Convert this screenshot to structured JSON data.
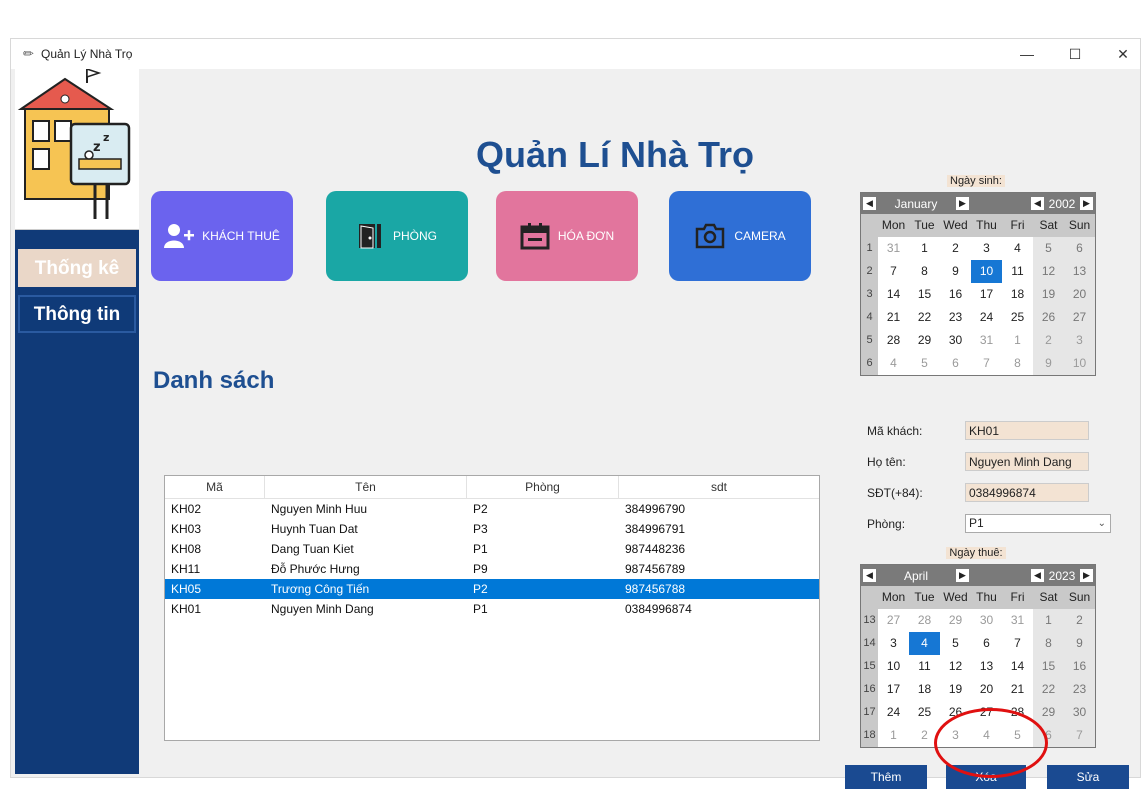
{
  "window": {
    "title": "Quản Lý Nhà Trọ"
  },
  "sidebar": {
    "items": [
      {
        "label": "Thống kê"
      },
      {
        "label": "Thông tin"
      }
    ]
  },
  "header": {
    "title": "Quản Lí Nhà Trọ"
  },
  "tiles": [
    {
      "label": "KHÁCH THUÊ",
      "color": "#6b63ee",
      "icon": "add-user-icon"
    },
    {
      "label": "PHÒNG",
      "color": "#1aa7a5",
      "icon": "door-icon"
    },
    {
      "label": "HÓA ĐƠN",
      "color": "#e2759d",
      "icon": "calendar-icon"
    },
    {
      "label": "CAMERA",
      "color": "#2f6fd6",
      "icon": "camera-icon"
    }
  ],
  "list": {
    "title": "Danh sách",
    "columns": [
      "Mã",
      "Tên",
      "Phòng",
      "sdt"
    ],
    "rows": [
      [
        "KH02",
        "Nguyen Minh Huu",
        "P2",
        "384996790"
      ],
      [
        "KH03",
        "Huynh Tuan Dat",
        "P3",
        "384996791"
      ],
      [
        "KH08",
        "Dang Tuan Kiet",
        "P1",
        "987448236"
      ],
      [
        "KH11",
        "Đỗ Phước Hưng",
        "P9",
        "987456789"
      ],
      [
        "KH05",
        "Trương Công Tiến",
        "P2",
        "987456788"
      ],
      [
        "KH01",
        "Nguyen Minh Dang",
        "P1",
        "0384996874"
      ]
    ],
    "selected_row": 4
  },
  "birth_calendar": {
    "label": "Ngày sinh:",
    "month": "January",
    "year": "2002",
    "weekdays": [
      "Mon",
      "Tue",
      "Wed",
      "Thu",
      "Fri",
      "Sat",
      "Sun"
    ],
    "weeks": [
      {
        "num": "1",
        "days": [
          "31",
          "1",
          "2",
          "3",
          "4",
          "5",
          "6"
        ]
      },
      {
        "num": "2",
        "days": [
          "7",
          "8",
          "9",
          "10",
          "11",
          "12",
          "13"
        ]
      },
      {
        "num": "3",
        "days": [
          "14",
          "15",
          "16",
          "17",
          "18",
          "19",
          "20"
        ]
      },
      {
        "num": "4",
        "days": [
          "21",
          "22",
          "23",
          "24",
          "25",
          "26",
          "27"
        ]
      },
      {
        "num": "5",
        "days": [
          "28",
          "29",
          "30",
          "31",
          "1",
          "2",
          "3"
        ]
      },
      {
        "num": "6",
        "days": [
          "4",
          "5",
          "6",
          "7",
          "8",
          "9",
          "10"
        ]
      }
    ],
    "first_week_prev_count": 1,
    "last_in_month_index": 30,
    "selected": "10"
  },
  "form": {
    "ma_khach": {
      "label": "Mã khách:",
      "value": "KH01"
    },
    "ho_ten": {
      "label": "Họ tên:",
      "value": "Nguyen Minh Dang"
    },
    "sdt": {
      "label": "SĐT(+84):",
      "value": "0384996874"
    },
    "phong": {
      "label": "Phòng:",
      "value": "P1"
    }
  },
  "rent_calendar": {
    "label": "Ngày thuê:",
    "month": "April",
    "year": "2023",
    "weekdays": [
      "Mon",
      "Tue",
      "Wed",
      "Thu",
      "Fri",
      "Sat",
      "Sun"
    ],
    "weeks": [
      {
        "num": "13",
        "days": [
          "27",
          "28",
          "29",
          "30",
          "31",
          "1",
          "2"
        ]
      },
      {
        "num": "14",
        "days": [
          "3",
          "4",
          "5",
          "6",
          "7",
          "8",
          "9"
        ]
      },
      {
        "num": "15",
        "days": [
          "10",
          "11",
          "12",
          "13",
          "14",
          "15",
          "16"
        ]
      },
      {
        "num": "16",
        "days": [
          "17",
          "18",
          "19",
          "20",
          "21",
          "22",
          "23"
        ]
      },
      {
        "num": "17",
        "days": [
          "24",
          "25",
          "26",
          "27",
          "28",
          "29",
          "30"
        ]
      },
      {
        "num": "18",
        "days": [
          "1",
          "2",
          "3",
          "4",
          "5",
          "6",
          "7"
        ]
      }
    ],
    "first_week_prev_count": 5,
    "last_in_month_index": 34,
    "selected": "4"
  },
  "actions": {
    "add": "Thêm",
    "delete": "Xóa",
    "edit": "Sửa"
  }
}
